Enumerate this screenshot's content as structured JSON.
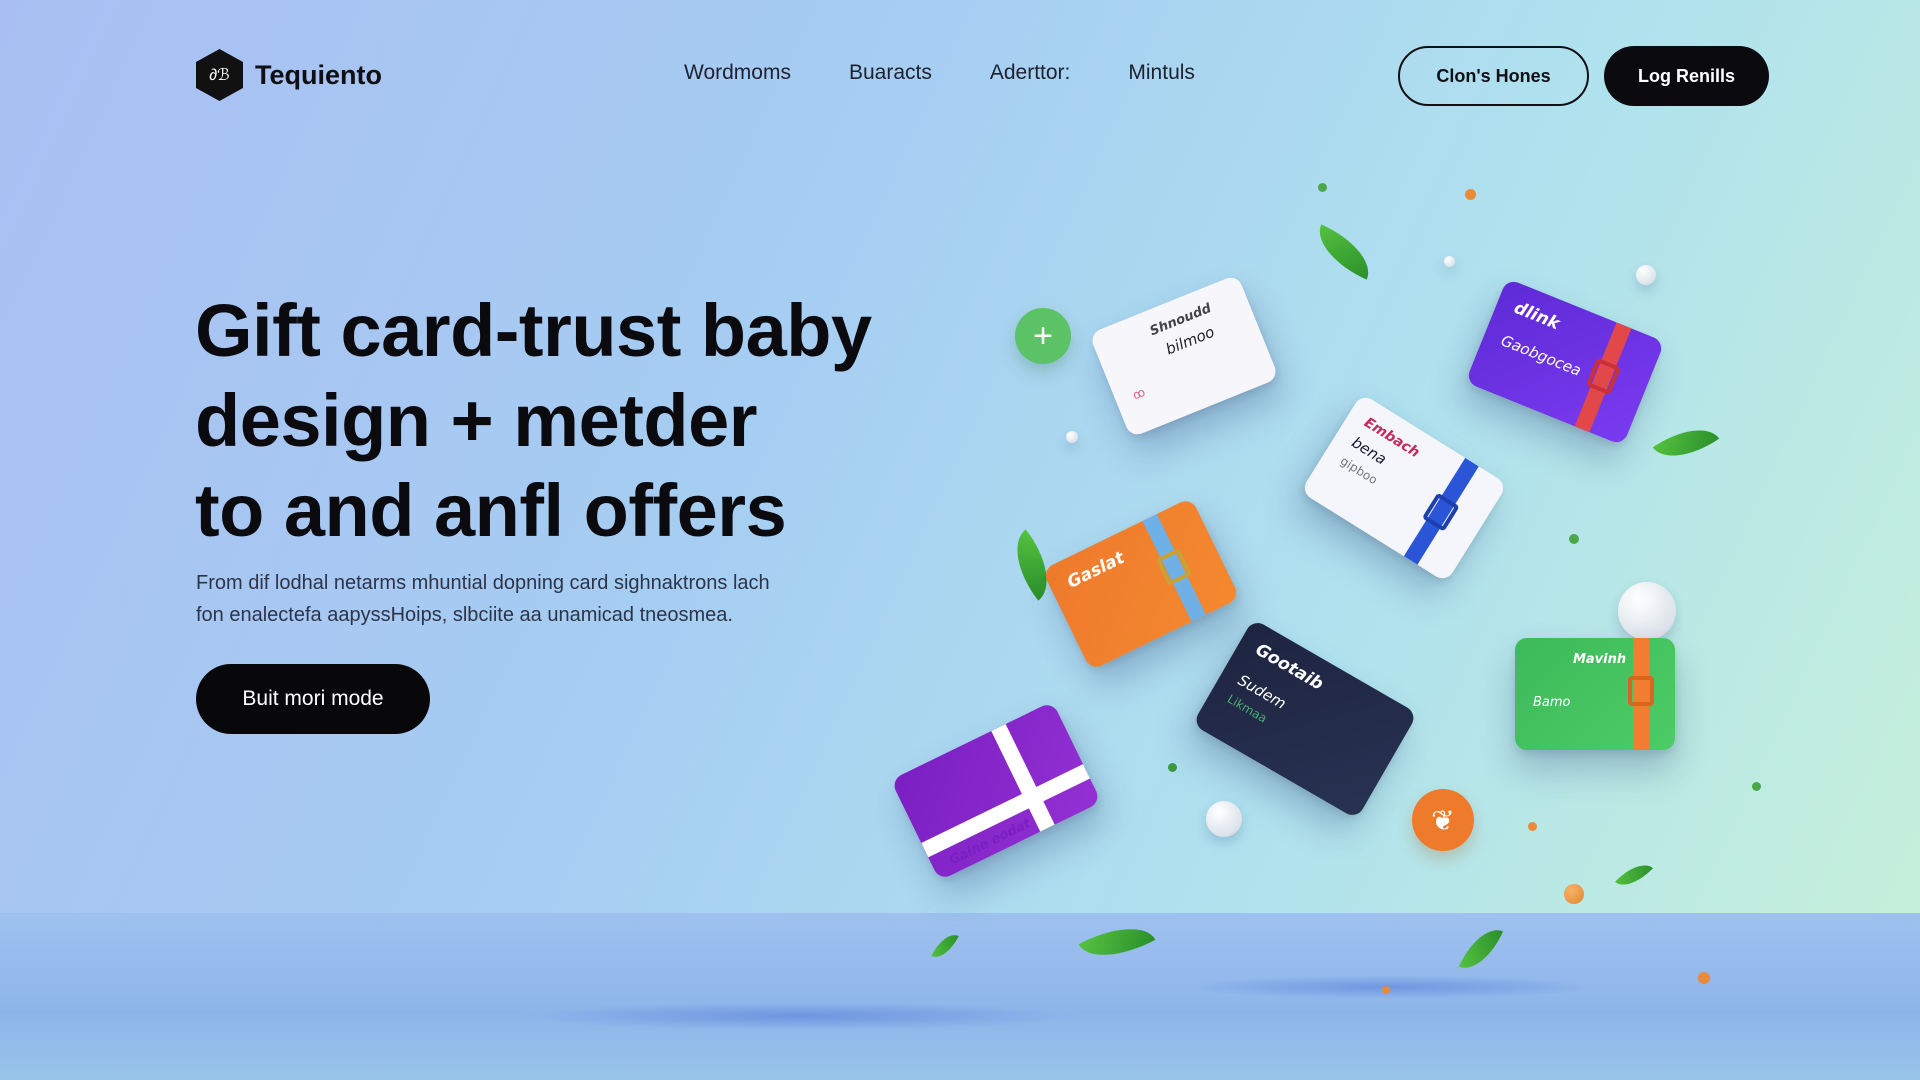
{
  "brand": {
    "name": "Tequiento",
    "logo_glyph": "∂ℬ"
  },
  "nav": {
    "items": [
      "Wordmoms",
      "Buaracts",
      "Aderttor:",
      "Mintuls"
    ]
  },
  "header_buttons": {
    "secondary_label": "Clon's Hones",
    "primary_label": "Log Renills"
  },
  "hero": {
    "title_lines": [
      "Gift card-trust baby",
      "design + metder",
      "to and anfl offers"
    ],
    "subtitle_lines": [
      "From dif lodhal netarms mhuntial dopning card sighnaktrons lach",
      "fon enalectefa aapyssHoips, slbciite aa unamicad tneosmea."
    ],
    "cta_label": "Buit mori mode"
  },
  "cards": {
    "white1": {
      "line1": "Shnoudd",
      "line2": "bilmoo",
      "line3": "ꝏ"
    },
    "purple": {
      "line1": "dlink",
      "line2": "Gaobgocea"
    },
    "white2": {
      "line1": "Embach",
      "line2": "bena",
      "line3": "gipboo"
    },
    "orange": {
      "line1": "Gaslat",
      "line2": ""
    },
    "navy": {
      "line1": "Gootaib",
      "line2": "Sudem",
      "line3": "Likmaa"
    },
    "green": {
      "line1": "Mavinh",
      "line2": "Bamo"
    },
    "violet": {
      "line1": "Gaine eodat"
    }
  },
  "icons": {
    "plus_badge": "plus-icon",
    "orange_badge": "gift-icon"
  },
  "colors": {
    "accent_dark": "#0b0b0f",
    "card_purple": "#6a31e3",
    "card_orange": "#ef7d2d",
    "card_navy": "#232b48",
    "card_green": "#45c462",
    "card_violet": "#8628cb",
    "leaf_green": "#3ea535"
  }
}
